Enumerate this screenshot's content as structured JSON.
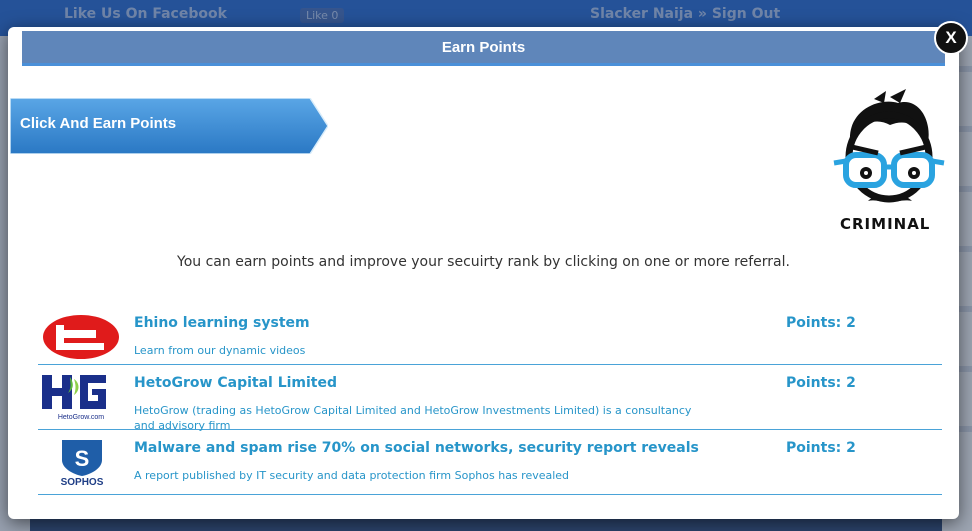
{
  "background": {
    "facebook_text": "Like Us On Facebook",
    "like_button": "Like 0",
    "user_text": "Slacker Naija » Sign Out"
  },
  "modal": {
    "title": "Earn Points",
    "close_label": "X",
    "ribbon_label": "Click And Earn Points",
    "mascot_label": "CRIMINAL",
    "intro": "You can earn points and improve your secuirty rank by clicking on one or more referral."
  },
  "referrals": [
    {
      "logo": "ehino-logo",
      "title": "Ehino learning system",
      "description": "Learn from our dynamic videos",
      "points": "Points: 2"
    },
    {
      "logo": "hetogrow-logo",
      "logo_caption": "HetoGrow.com",
      "title": "HetoGrow Capital Limited",
      "description": "HetoGrow (trading as HetoGrow Capital Limited and HetoGrow Investments Limited) is a consultancy and advisory firm",
      "points": "Points: 2"
    },
    {
      "logo": "sophos-logo",
      "logo_caption": "SOPHOS",
      "title": "Malware and spam rise 70% on social networks, security report reveals",
      "description": "A report published by IT security and data protection firm Sophos has revealed",
      "points": "Points: 2"
    }
  ],
  "colors": {
    "header": "#5f86ba",
    "link": "#2795c9",
    "ribbon": "#3f8fd6"
  }
}
